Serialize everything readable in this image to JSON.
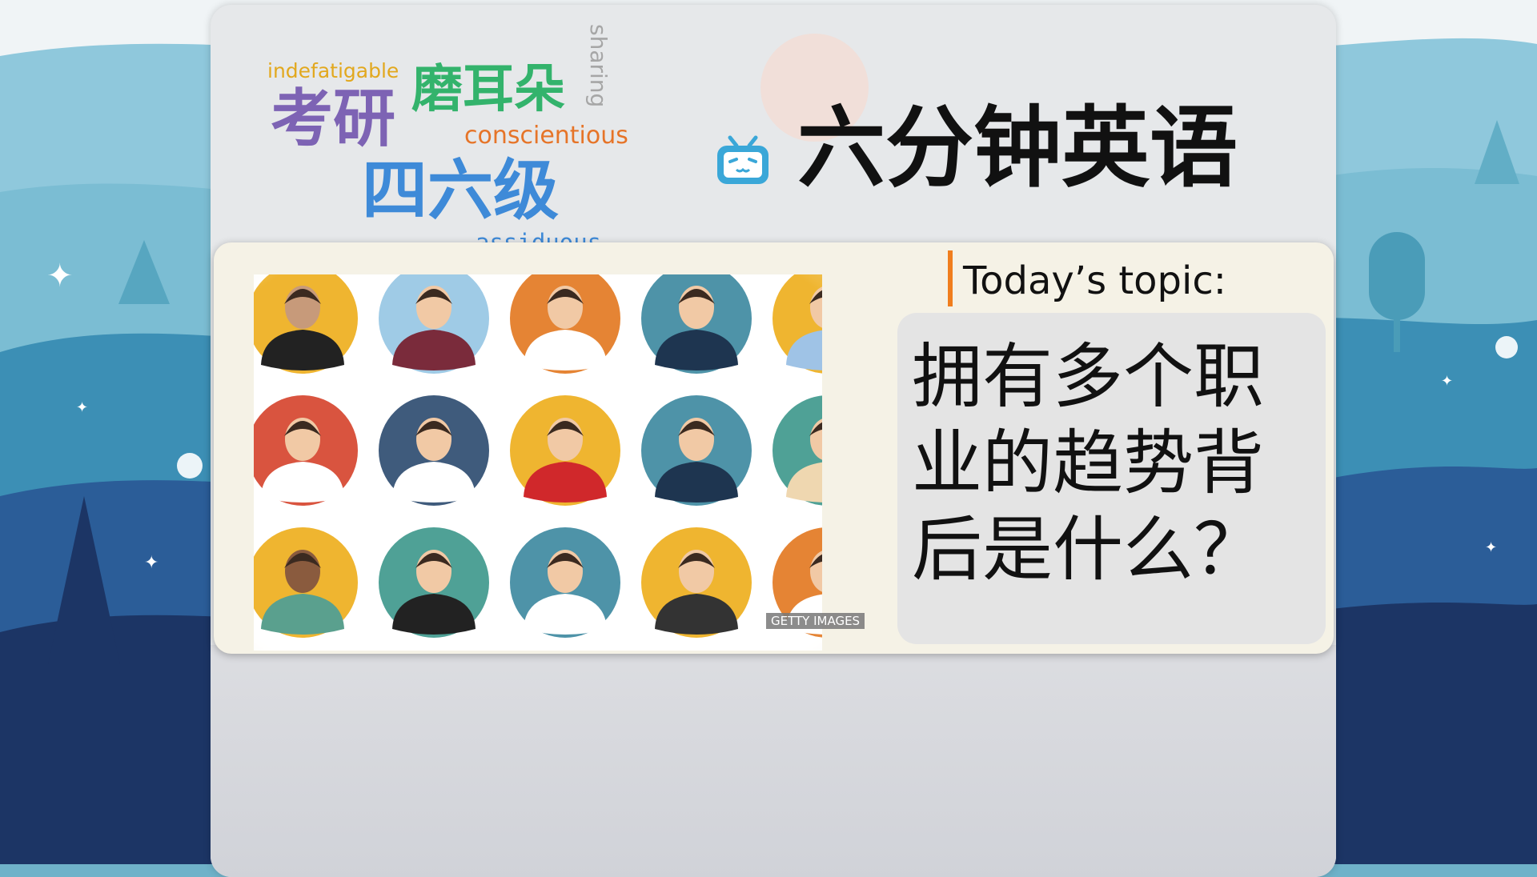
{
  "branding": {
    "title": "六分钟英语",
    "logo_icon": "bilibili-tv-icon"
  },
  "word_cloud": {
    "indefatigable": "indefatigable",
    "kaoyan": "考研",
    "moerduo": "磨耳朵",
    "sharing": "sharing",
    "conscientious": "conscientious",
    "siliuji": "四六级",
    "assiduous": "assiduous"
  },
  "topic": {
    "label": "Today’s topic:",
    "question": "拥有多个职业的趋势背后是什么？"
  },
  "image": {
    "credit": "GETTY IMAGES",
    "avatars": [
      {
        "role": "waiter",
        "bg": "#efb530"
      },
      {
        "role": "businesswoman",
        "bg": "#9fcbe6"
      },
      {
        "role": "chef",
        "bg": "#e58434"
      },
      {
        "role": "policewoman",
        "bg": "#4e93a8"
      },
      {
        "role": "postman",
        "bg": "#efb530"
      },
      {
        "role": "gentleman",
        "bg": "#d9543f"
      },
      {
        "role": "doctor",
        "bg": "#3f5b7c"
      },
      {
        "role": "firefighter",
        "bg": "#efb530"
      },
      {
        "role": "police-officer",
        "bg": "#4e93a8"
      },
      {
        "role": "teacher",
        "bg": "#4fa196"
      },
      {
        "role": "farmer",
        "bg": "#efb530"
      },
      {
        "role": "graduate",
        "bg": "#4fa196"
      },
      {
        "role": "captain",
        "bg": "#4e93a8"
      },
      {
        "role": "operator-woman",
        "bg": "#efb530"
      },
      {
        "role": "operator-man",
        "bg": "#e58434"
      }
    ]
  },
  "colors": {
    "accent": "#f07e1e",
    "logo": "#3aa7d8"
  }
}
